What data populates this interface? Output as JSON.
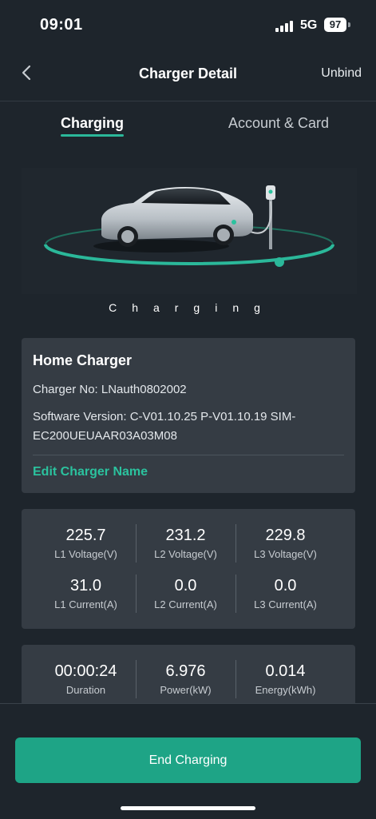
{
  "status_bar": {
    "time": "09:01",
    "network": "5G",
    "battery": "97"
  },
  "nav": {
    "title": "Charger Detail",
    "right_action": "Unbind"
  },
  "tabs": [
    {
      "label": "Charging",
      "active": true
    },
    {
      "label": "Account & Card",
      "active": false
    }
  ],
  "charging_status": "Charging",
  "charger": {
    "name": "Home Charger",
    "number_line": "Charger No: LNauth0802002",
    "software_line_1": "Software Version: C-V01.10.25 P-V01.10.19 SIM-",
    "software_line_2": "EC200UEUAAR03A03M08",
    "edit_label": "Edit Charger Name"
  },
  "metrics": [
    {
      "value": "225.7",
      "label": "L1 Voltage(V)"
    },
    {
      "value": "231.2",
      "label": "L2 Voltage(V)"
    },
    {
      "value": "229.8",
      "label": "L3 Voltage(V)"
    },
    {
      "value": "31.0",
      "label": "L1 Current(A)"
    },
    {
      "value": "0.0",
      "label": "L2 Current(A)"
    },
    {
      "value": "0.0",
      "label": "L3 Current(A)"
    }
  ],
  "session": [
    {
      "value": "00:00:24",
      "label": "Duration"
    },
    {
      "value": "6.976",
      "label": "Power(kW)"
    },
    {
      "value": "0.014",
      "label": "Energy(kWh)"
    }
  ],
  "end_button_label": "End Charging",
  "colors": {
    "accent": "#2bc29e",
    "button": "#1ea486",
    "background": "#1e252c",
    "card": "#353c44"
  }
}
